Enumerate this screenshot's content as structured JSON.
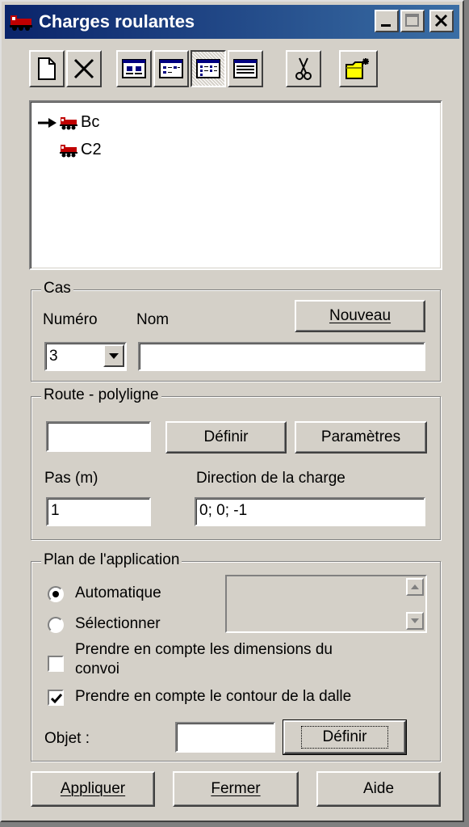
{
  "window": {
    "title": "Charges roulantes"
  },
  "toolbar": {
    "icons": [
      "new-document-icon",
      "delete-icon",
      "view-large-icons-icon",
      "view-small-icons-icon",
      "view-list-icon",
      "view-details-icon",
      "cut-icon",
      "open-folder-icon"
    ]
  },
  "tree": {
    "items": [
      {
        "label": "Bc",
        "selected": true
      },
      {
        "label": "C2",
        "selected": false
      }
    ]
  },
  "cas": {
    "legend": "Cas",
    "numero_label": "Numéro",
    "nom_label": "Nom",
    "nouveau_button": "Nouveau",
    "numero_value": "3",
    "nom_value": ""
  },
  "route": {
    "legend": "Route - polyligne",
    "polyline_value": "",
    "definir_button": "Définir",
    "parametres_button": "Paramètres",
    "pas_label": "Pas (m)",
    "pas_value": "1",
    "direction_label": "Direction de la charge",
    "direction_value": "0; 0; -1"
  },
  "plan": {
    "legend": "Plan de l'application",
    "radio_auto": "Automatique",
    "radio_select": "Sélectionner",
    "auto_selected": true,
    "check_dimensions_line1": "Prendre en compte les dimensions du",
    "check_dimensions_line2": "convoi",
    "check_dimensions": false,
    "check_contour": "Prendre en compte le contour de la dalle",
    "check_contour_checked": true,
    "objet_label": "Objet :",
    "objet_value": "",
    "definir_button": "Définir"
  },
  "footer": {
    "appliquer": "Appliquer",
    "fermer": "Fermer",
    "aide": "Aide"
  },
  "colors": {
    "titlebar_start": "#0a246a",
    "titlebar_end": "#3a6ea5",
    "face": "#d4d0c8",
    "icon_red": "#c00000"
  }
}
